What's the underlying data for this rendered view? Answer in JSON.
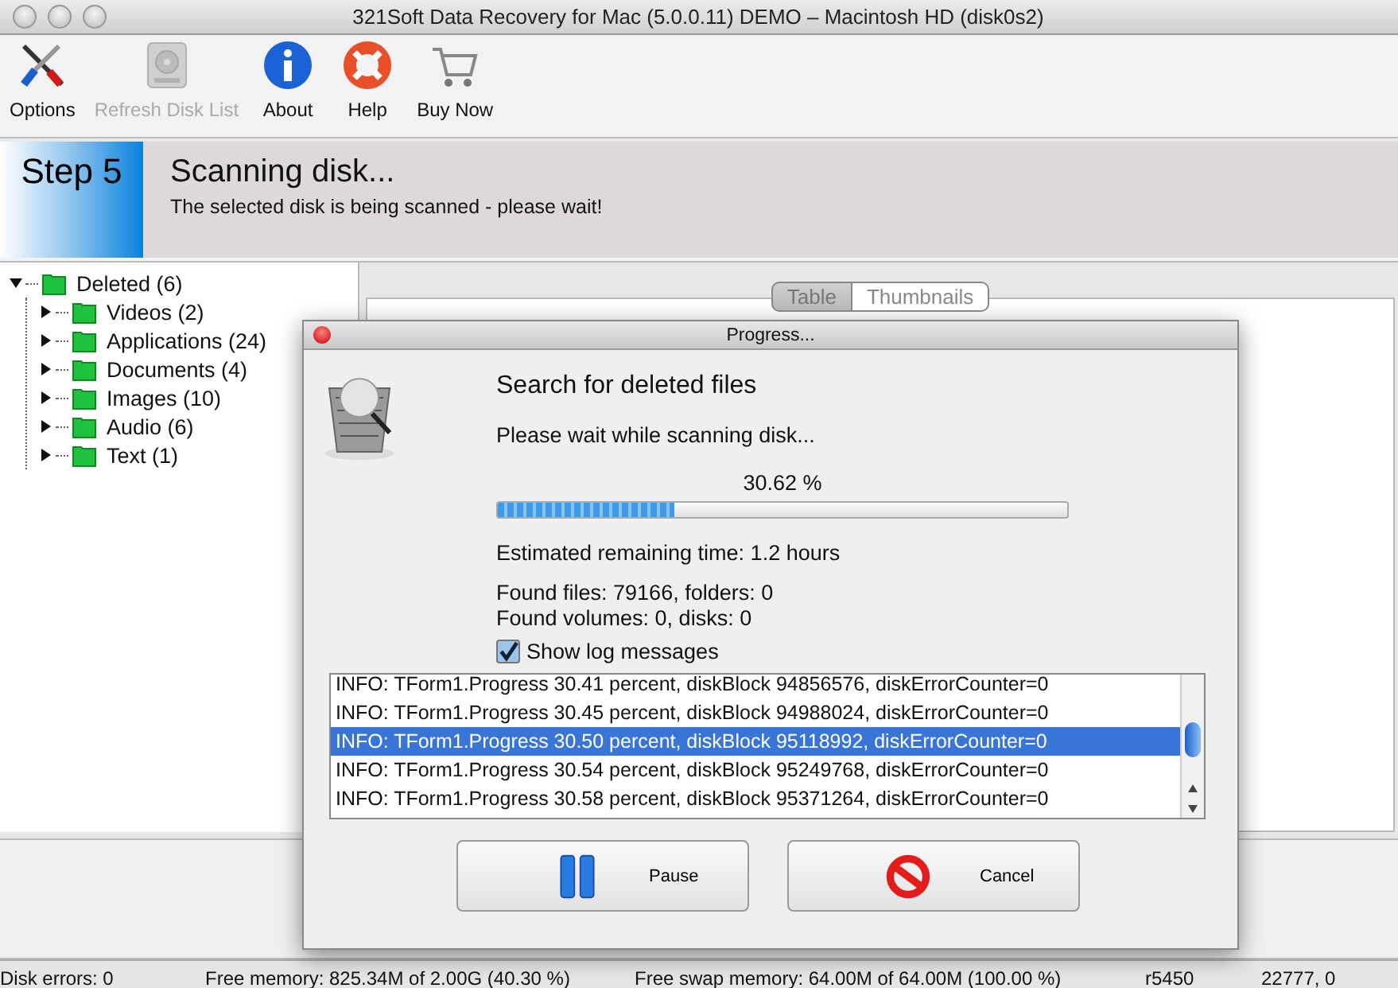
{
  "window": {
    "title": "321Soft Data Recovery for Mac (5.0.0.11) DEMO – Macintosh HD (disk0s2)"
  },
  "toolbar": [
    {
      "label": "Options",
      "kind": "tools",
      "disabled": false
    },
    {
      "label": "Refresh Disk List",
      "kind": "disk",
      "disabled": true
    },
    {
      "label": "About",
      "kind": "info",
      "disabled": false
    },
    {
      "label": "Help",
      "kind": "lifebuoy",
      "disabled": false
    },
    {
      "label": "Buy Now",
      "kind": "cart",
      "disabled": false
    }
  ],
  "step": {
    "label": "Step 5",
    "title": "Scanning disk...",
    "subtitle": "The selected disk is being scanned - please wait!"
  },
  "tree": {
    "label": "Deleted (6)",
    "expanded": true,
    "children": [
      {
        "label": "Videos (2)",
        "expanded": false
      },
      {
        "label": "Applications (24)",
        "expanded": false
      },
      {
        "label": "Documents (4)",
        "expanded": false
      },
      {
        "label": "Images (10)",
        "expanded": false
      },
      {
        "label": "Audio (6)",
        "expanded": false
      },
      {
        "label": "Text (1)",
        "expanded": false
      }
    ]
  },
  "view_tabs": [
    {
      "label": "Table",
      "selected": true
    },
    {
      "label": "Thumbnails",
      "selected": false
    }
  ],
  "progress_dialog": {
    "title": "Progress...",
    "heading": "Search for deleted files",
    "message": "Please wait while scanning disk...",
    "percent": "30.62 %",
    "level": 0.31,
    "remaining": "Estimated remaining time: 1.2 hours",
    "found_files": "Found files: 79166, folders: 0",
    "found_volumes": "Found volumes: 0, disks: 0",
    "show_log": {
      "label": "Show log messages",
      "checked": true
    },
    "log": [
      {
        "text": "INFO: TForm1.Progress 30.41 percent, diskBlock 94856576, diskErrorCounter=0",
        "selected": false
      },
      {
        "text": "INFO: TForm1.Progress 30.45 percent, diskBlock 94988024, diskErrorCounter=0",
        "selected": false
      },
      {
        "text": "INFO: TForm1.Progress 30.50 percent, diskBlock 95118992, diskErrorCounter=0",
        "selected": true
      },
      {
        "text": "INFO: TForm1.Progress 30.54 percent, diskBlock 95249768, diskErrorCounter=0",
        "selected": false
      },
      {
        "text": "INFO: TForm1.Progress 30.58 percent, diskBlock 95371264, diskErrorCounter=0",
        "selected": false
      }
    ],
    "buttons": [
      {
        "label": "Pause",
        "kind": "pause"
      },
      {
        "label": "Cancel",
        "kind": "cancel"
      }
    ]
  },
  "status_bar": [
    "Disk errors: 0",
    "Free memory: 825.34M of 2.00G (40.30 %)",
    "Free swap memory: 64.00M of 64.00M (100.00 %)",
    "r5450",
    "22777, 0"
  ]
}
